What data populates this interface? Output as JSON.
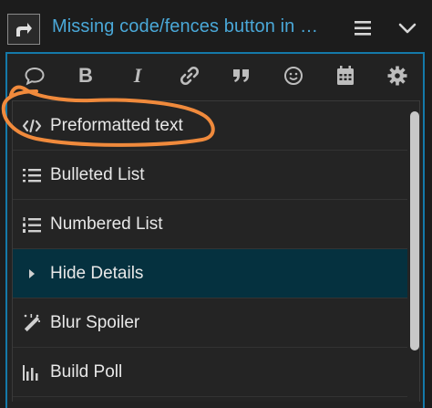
{
  "header": {
    "title": "Missing code/fences button in …",
    "reply_icon": "share-arrow-icon",
    "menu_icon": "hamburger-icon",
    "toggle_icon": "chevron-down-icon"
  },
  "toolbar": {
    "icons": [
      "quote-icon",
      "bold-icon",
      "italic-icon",
      "link-icon",
      "blockquote-icon",
      "emoji-icon",
      "calendar-icon",
      "gear-icon"
    ],
    "bold_label": "B",
    "italic_label": "I"
  },
  "dropdown": {
    "items": [
      {
        "label": "Preformatted text",
        "icon": "code-icon",
        "active": false
      },
      {
        "label": "Bulleted List",
        "icon": "bulleted-list-icon",
        "active": false
      },
      {
        "label": "Numbered List",
        "icon": "numbered-list-icon",
        "active": false
      },
      {
        "label": "Hide Details",
        "icon": "caret-right-icon",
        "active": true
      },
      {
        "label": "Blur Spoiler",
        "icon": "magic-wand-icon",
        "active": false
      },
      {
        "label": "Build Poll",
        "icon": "bar-chart-icon",
        "active": false
      }
    ]
  },
  "colors": {
    "accent": "#1479a9",
    "title": "#4aa8d8",
    "active_row": "#05313f",
    "annotation": "#f08a3c"
  }
}
